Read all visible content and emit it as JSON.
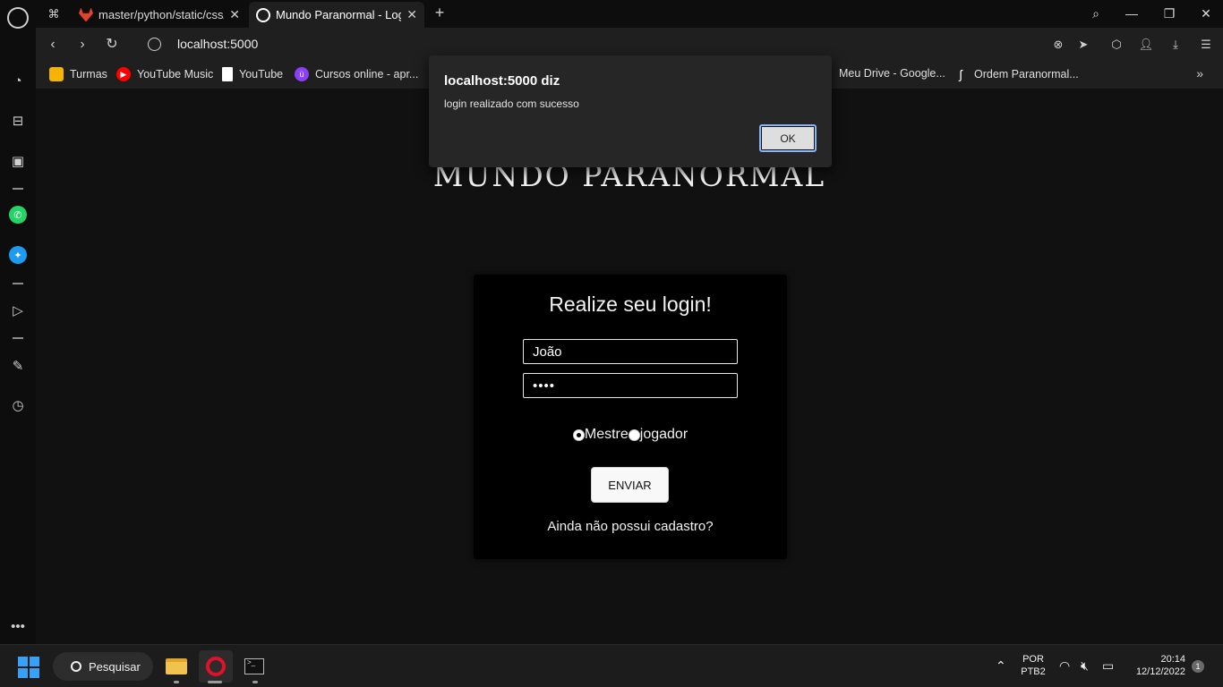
{
  "tabs": [
    {
      "title": "master/python/static/css/u"
    },
    {
      "title": "Mundo Paranormal - Login"
    }
  ],
  "window_controls": {
    "search": "⌕",
    "minimize": "—",
    "restore": "❐",
    "close": "✕"
  },
  "address": {
    "url": "localhost:5000"
  },
  "bookmarks": [
    {
      "label": "Turmas",
      "color": "#f4b400"
    },
    {
      "label": "YouTube Music",
      "color": "#ff0000"
    },
    {
      "label": "YouTube",
      "color": "#ffffff"
    },
    {
      "label": "Cursos online - apr...",
      "color": "#8a3ffc"
    },
    {
      "label": "Meu Drive - Google...",
      "color": "#1fa463"
    },
    {
      "label": "Ordem Paranormal...",
      "color": "#ffffff"
    }
  ],
  "page": {
    "site_title": "MUNDO PARANORMAL",
    "login": {
      "heading": "Realize seu login!",
      "username_value": "João",
      "password_value": "••••",
      "role_options": [
        {
          "label": "Mestre",
          "selected": true
        },
        {
          "label": "jogador",
          "selected": false
        }
      ],
      "submit_label": "ENVIAR",
      "register_link": "Ainda não possui cadastro?"
    }
  },
  "alert": {
    "title": "localhost:5000 diz",
    "message": "login realizado com sucesso",
    "ok_label": "OK"
  },
  "taskbar": {
    "search_label": "Pesquisar",
    "language_top": "POR",
    "language_bottom": "PTB2",
    "time": "20:14",
    "date": "12/12/2022",
    "notification_count": "1"
  }
}
